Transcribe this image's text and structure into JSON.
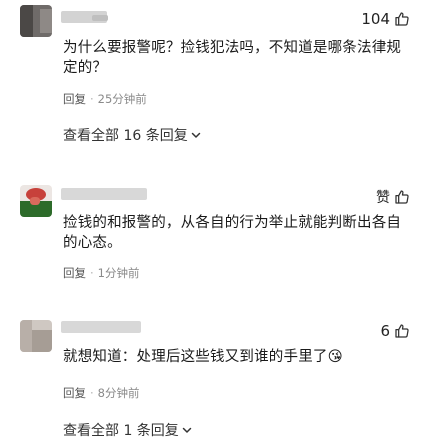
{
  "comments": [
    {
      "text": "为什么要报警呢？捡钱犯法吗，不知道是哪条法律规定的？",
      "likes": "104",
      "reply_label": "回复",
      "separator": "·",
      "time": "25分钟前",
      "more_replies": "查看全部 16 条回复"
    },
    {
      "text": "捡钱的和报警的，从各自的行为举止就能判断出各自的心态。",
      "likes": "赞",
      "reply_label": "回复",
      "separator": "·",
      "time": "1分钟前"
    },
    {
      "text": "就想知道：处理后这些钱又到谁的手里了",
      "emoji": "😘",
      "likes": "6",
      "reply_label": "回复",
      "separator": "·",
      "time": "8分钟前",
      "more_replies": "查看全部 1 条回复"
    }
  ],
  "icons": {
    "like": "thumbs-up-icon",
    "chevron": "chevron-down-icon"
  }
}
